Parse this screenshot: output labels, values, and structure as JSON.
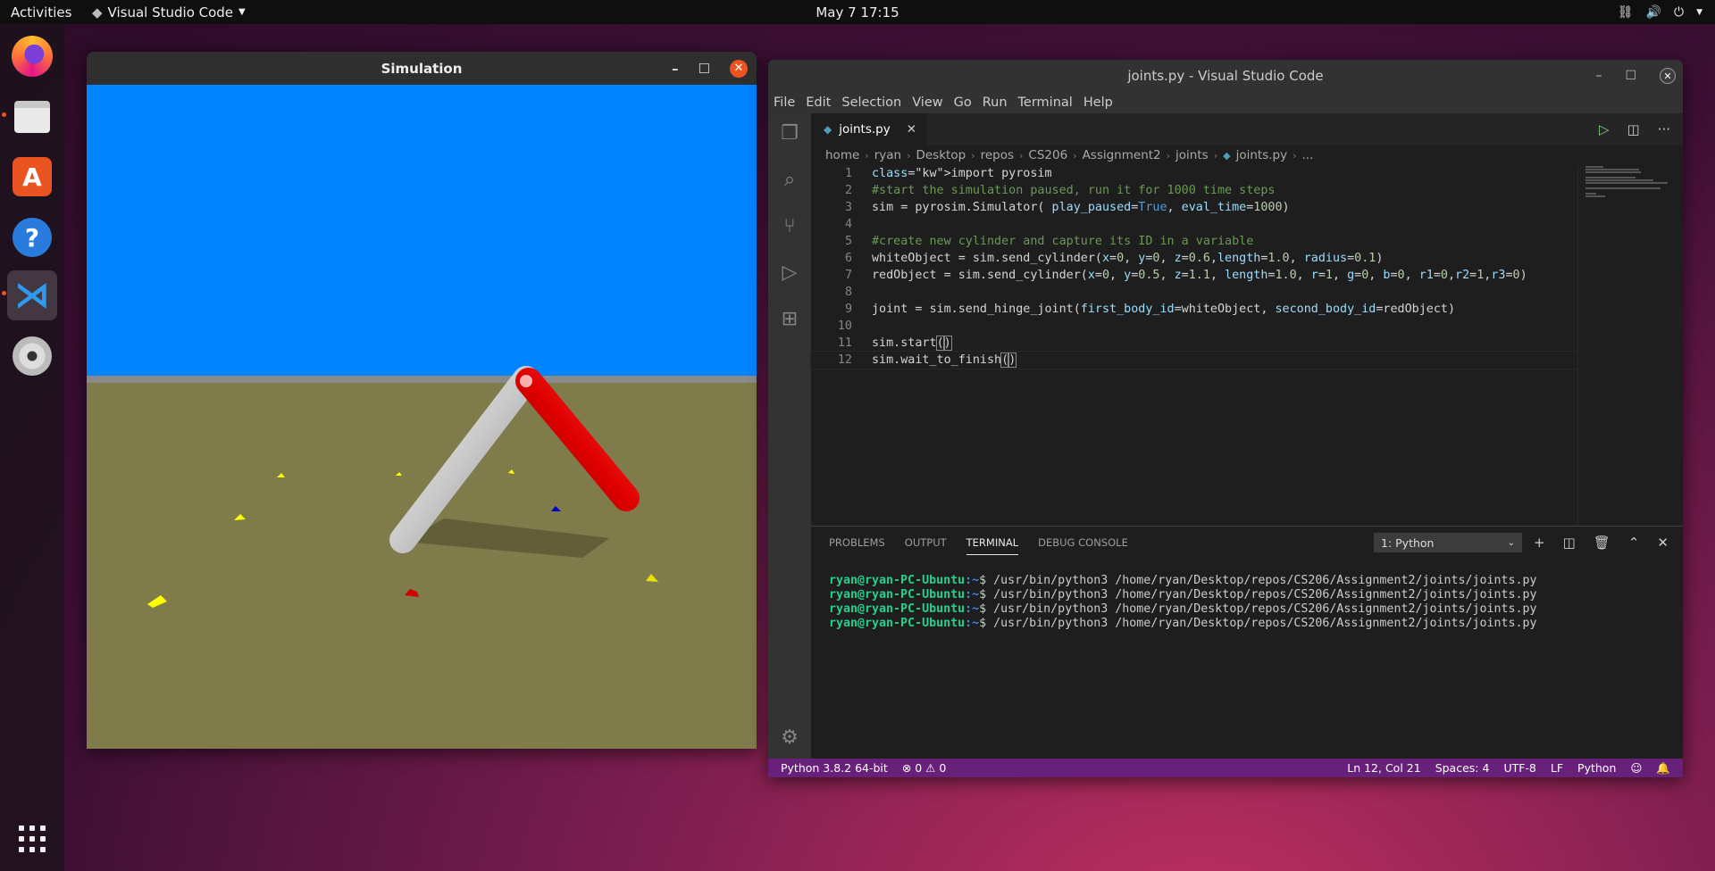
{
  "topbar": {
    "activities": "Activities",
    "app_name": "Visual Studio Code",
    "clock": "May 7  17:15"
  },
  "colors": {
    "sky": "#0084ff",
    "ground": "#7f7b4a",
    "accent": "#e95420",
    "statusbar": "#68217a"
  },
  "dock": {
    "icons": [
      "firefox-icon",
      "files-icon",
      "software-store-icon",
      "help-icon",
      "vscode-icon",
      "disc-icon",
      "show-apps-icon"
    ]
  },
  "simulation": {
    "title": "Simulation"
  },
  "vscode": {
    "title": "joints.py - Visual Studio Code",
    "menu": [
      "File",
      "Edit",
      "Selection",
      "View",
      "Go",
      "Run",
      "Terminal",
      "Help"
    ],
    "tab": "joints.py",
    "breadcrumb": [
      "home",
      "ryan",
      "Desktop",
      "repos",
      "CS206",
      "Assignment2",
      "joints",
      "joints.py",
      "..."
    ],
    "code_lines": [
      "import pyrosim",
      "#start the simulation paused, run it for 1000 time steps",
      "sim = pyrosim.Simulator( play_paused=True, eval_time=1000)",
      "",
      "#create new cylinder and capture its ID in a variable",
      "whiteObject = sim.send_cylinder(x=0, y=0, z=0.6,length=1.0, radius=0.1)",
      "redObject = sim.send_cylinder(x=0, y=0.5, z=1.1, length=1.0, r=1, g=0, b=0, r1=0,r2=1,r3=0)",
      "",
      "joint = sim.send_hinge_joint(first_body_id=whiteObject, second_body_id=redObject)",
      "",
      "sim.start()",
      "sim.wait_to_finish()"
    ],
    "panel_tabs": [
      "PROBLEMS",
      "OUTPUT",
      "TERMINAL",
      "DEBUG CONSOLE"
    ],
    "active_panel_tab": "TERMINAL",
    "terminal_select": "1: Python",
    "terminal": {
      "user": "ryan@ryan-PC-Ubuntu",
      "path": ":~",
      "command": "$ /usr/bin/python3 /home/ryan/Desktop/repos/CS206/Assignment2/joints/joints.py",
      "count": 4
    },
    "status": {
      "interpreter": "Python 3.8.2 64-bit",
      "problems": "⊗ 0 ⚠ 0",
      "position": "Ln 12, Col 21",
      "spaces": "Spaces: 4",
      "encoding": "UTF-8",
      "eol": "LF",
      "language": "Python"
    }
  }
}
